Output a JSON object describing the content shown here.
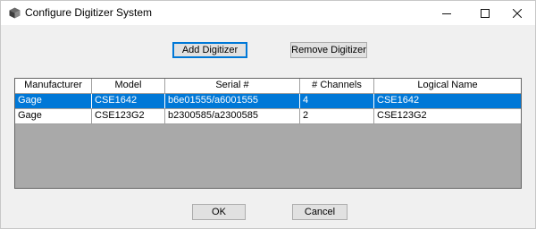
{
  "window": {
    "title": "Configure Digitizer System",
    "icon": "digitizer-app-icon",
    "controls": {
      "minimize": "minimize-icon",
      "maximize": "maximize-icon",
      "close": "close-icon"
    }
  },
  "toolbar": {
    "add_label": "Add Digitizer",
    "remove_label": "Remove Digitizer"
  },
  "table": {
    "columns": [
      "Manufacturer",
      "Model",
      "Serial #",
      "# Channels",
      "Logical Name"
    ],
    "rows": [
      {
        "selected": true,
        "cells": [
          "Gage",
          "CSE1642",
          "b6e01555/a6001555",
          "4",
          "CSE1642"
        ]
      },
      {
        "selected": false,
        "cells": [
          "Gage",
          "CSE123G2",
          "b2300585/a2300585",
          "2",
          "CSE123G2"
        ]
      }
    ]
  },
  "footer": {
    "ok_label": "OK",
    "cancel_label": "Cancel"
  },
  "colors": {
    "selection": "#0078d7",
    "grid_background": "#a9a9a9",
    "dialog_background": "#f0f0f0"
  }
}
